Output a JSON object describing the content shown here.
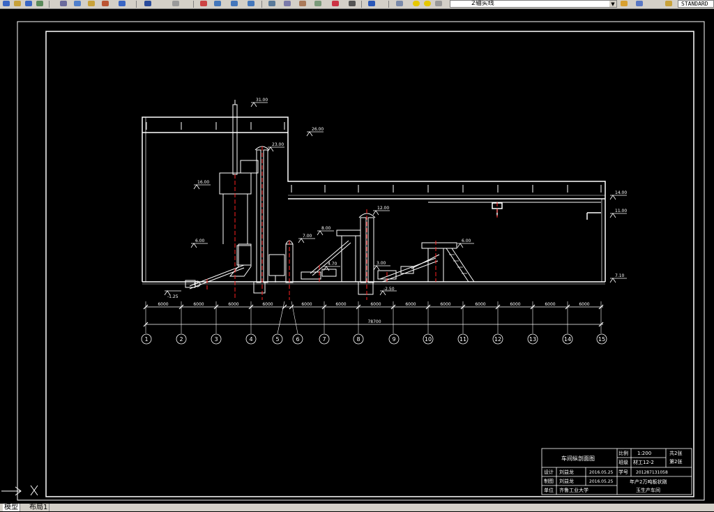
{
  "toolbar": {
    "layer_name": "2轴实线",
    "text_style": "STANDARD"
  },
  "drawing": {
    "elevations": [
      "31.00",
      "26.00",
      "23.00",
      "16.00",
      "14.00",
      "12.00",
      "11.00",
      "8.00",
      "7.00",
      "6.00",
      "6.00",
      "4.70",
      "3.00",
      "7.10",
      "-1.25",
      "-2.50"
    ],
    "spans": [
      "6000",
      "6000",
      "6000",
      "6000",
      "6000",
      "6000",
      "6000",
      "6000",
      "6000",
      "6000",
      "6000",
      "6000",
      "6000"
    ],
    "total_length": "78700",
    "axis_numbers": [
      "1",
      "2",
      "3",
      "4",
      "5",
      "6",
      "7",
      "8",
      "9",
      "10",
      "11",
      "12",
      "13",
      "14",
      "15"
    ]
  },
  "title_block": {
    "drawing_title": "车间纵剖面图",
    "scale_label": "比例",
    "scale_value": "1:200",
    "class_label": "班级",
    "class_value": "材工12-2",
    "total_sheets": "共2张",
    "sheet_no": "第2张",
    "student_id_label": "学号",
    "student_id": "201287131058",
    "design_label": "设计",
    "design_name": "刘益龙",
    "design_date": "2016.05.25",
    "draw_label": "制图",
    "draw_name": "刘益龙",
    "draw_date": "2016.05.25",
    "unit_label": "单位",
    "unit_name": "齐鲁工业大学",
    "project_line1": "年产2万吨板状刚",
    "project_line2": "玉生产车间"
  },
  "tabs": {
    "model": "模型",
    "layout1": "布局1"
  }
}
